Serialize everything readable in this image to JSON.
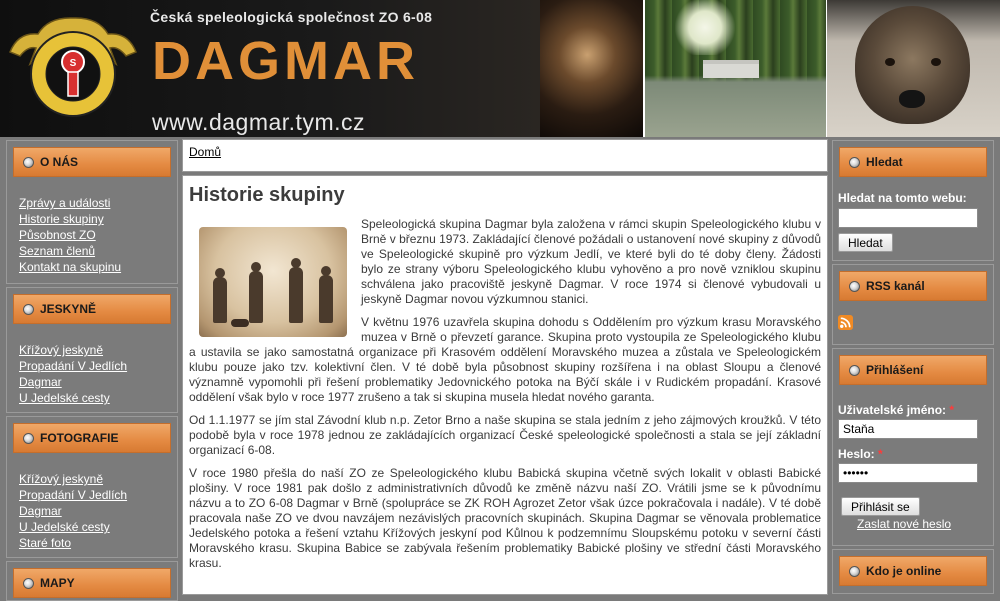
{
  "header": {
    "subtitle": "Česká speleologická společnost ZO 6-08",
    "title": "DAGMAR",
    "url": "www.dagmar.tym.cz",
    "logo_text_top": "ČESKÁ",
    "logo_text_ring": "SPELEOLOGICKÁ SPOLEČNOST"
  },
  "left_sidebar": {
    "sections": [
      {
        "heading": "O NÁS",
        "links": [
          "Zprávy a události",
          "Historie skupiny",
          "Působnost ZO",
          "Seznam členů",
          "Kontakt na skupinu"
        ]
      },
      {
        "heading": "JESKYNĚ",
        "links": [
          "Křížový jeskyně",
          "Propadání V Jedlích",
          "Dagmar",
          "U Jedelské cesty"
        ]
      },
      {
        "heading": "FOTOGRAFIE",
        "links": [
          "Křížový jeskyně",
          "Propadání V Jedlích",
          "Dagmar",
          "U Jedelské cesty",
          "Staré foto"
        ]
      },
      {
        "heading": "MAPY",
        "links": []
      }
    ]
  },
  "breadcrumb": {
    "home": "Domů"
  },
  "article": {
    "title": "Historie skupiny",
    "paragraphs": [
      "Speleologická skupina Dagmar byla založena v rámci skupin Speleologického klubu v Brně v březnu 1973. Zakládající členové požádali o ustanovení nové skupiny z důvodů ve Speleologické skupině pro výzkum Jedlí, ve které byli do té doby členy. Žádosti bylo ze strany výboru Speleologického klubu vyhověno a pro nově vzniklou skupinu schválena jako pracoviště jeskyně Dagmar. V roce 1974 si členové vybudovali u jeskyně Dagmar novou výzkumnou stanici.",
      "V květnu 1976 uzavřela skupina dohodu s Oddělením pro výzkum krasu Moravského muzea v Brně o převzetí garance. Skupina proto vystoupila ze Speleologického klubu a ustavila se jako samostatná organizace při Krasovém oddělení Moravského muzea a zůstala ve Speleologickém klubu pouze jako tzv. kolektivní člen. V té době byla působnost skupiny rozšířena i na oblast Sloupu a členové významně vypomohli při řešení problematiky Jedovnického potoka na Býčí skále i v Rudickém propadání. Krasové oddělení však bylo v roce 1977 zrušeno a tak si skupina musela hledat nového garanta.",
      "Od 1.1.1977 se jím stal Závodní klub n.p. Zetor Brno a naše skupina se stala jedním z jeho zájmových kroužků. V této podobě byla v roce 1978 jednou ze zakládajících organizací České speleologické společnosti a stala se její základní organizací 6-08.",
      "V roce 1980 přešla do naší ZO ze Speleologického klubu Babická skupina včetně svých lokalit v oblasti Babické plošiny. V roce 1981 pak došlo z administrativních důvodů ke změně názvu naší ZO. Vrátili jsme se k původnímu názvu a to ZO 6-08 Dagmar v Brně (spolupráce se ZK ROH Agrozet Zetor však úzce pokračovala i nadále). V té době pracovala naše ZO ve dvou navzájem nezávislých pracovních skupinách. Skupina Dagmar se věnovala problematice Jedelského potoka a řešení vztahu Křížových jeskyní pod Kůlnou k podzemnímu Sloupskému potoku v severní části Moravského krasu. Skupina Babice se zabývala řešením problematiky Babické plošiny ve střední části Moravského krasu."
    ]
  },
  "right_sidebar": {
    "search": {
      "heading": "Hledat",
      "label": "Hledat na tomto webu:",
      "value": "",
      "button": "Hledat"
    },
    "rss": {
      "heading": "RSS kanál",
      "icon": "rss-icon"
    },
    "login": {
      "heading": "Přihlášení",
      "username_label": "Uživatelské jméno:",
      "required_mark": "*",
      "username_value": "Staňa",
      "password_label": "Heslo:",
      "password_value": "••••••",
      "submit": "Přihlásit se",
      "forgot_link": "Zaslat nové heslo"
    },
    "online": {
      "heading": "Kdo je online"
    }
  },
  "colors": {
    "accent_orange": "#e48a42",
    "title_orange": "#e08f38",
    "sidebar_gray": "#7b7b7b"
  }
}
